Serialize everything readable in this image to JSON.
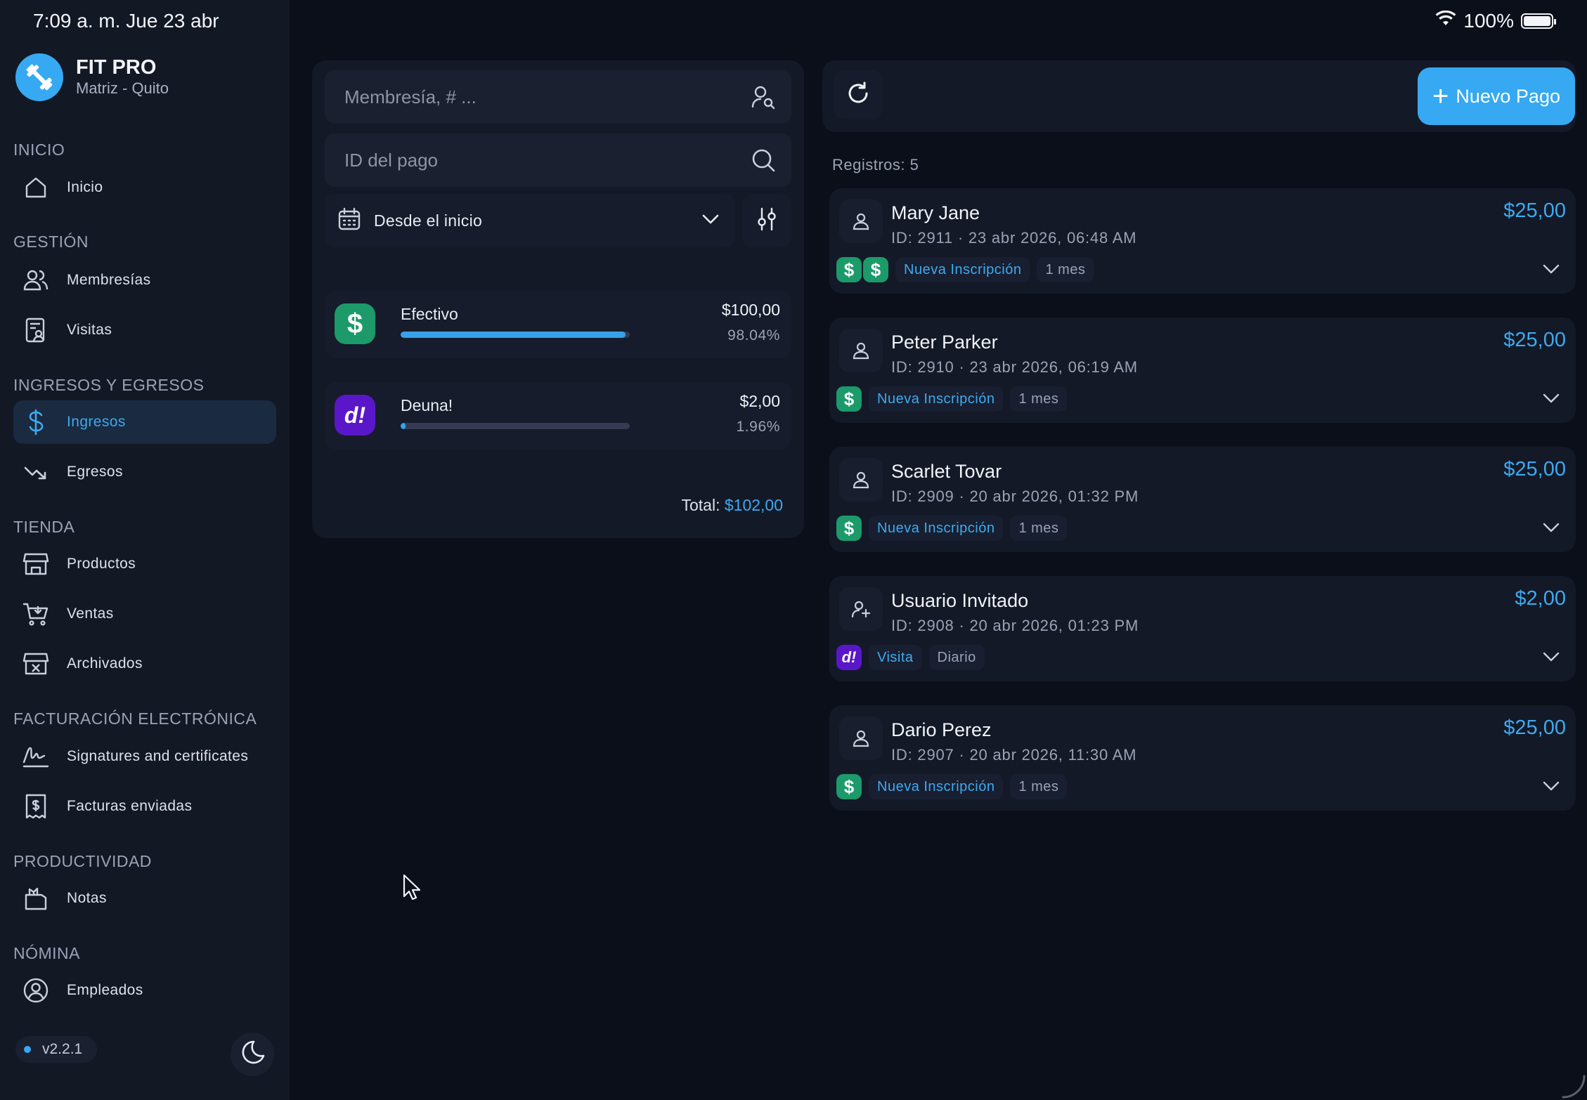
{
  "status_bar": {
    "time": "7:09 a. m.   Jue 23 abr",
    "battery": "100%",
    "battery_level": 1.0
  },
  "brand": {
    "name": "FIT PRO",
    "subtitle": "Matriz - Quito"
  },
  "sidebar": {
    "sections": [
      {
        "title": "INICIO"
      },
      {
        "title": "GESTIÓN"
      },
      {
        "title": "INGRESOS Y EGRESOS"
      },
      {
        "title": "TIENDA"
      },
      {
        "title": "FACTURACIÓN ELECTRÓNICA"
      },
      {
        "title": "PRODUCTIVIDAD"
      },
      {
        "title": "NÓMINA"
      }
    ],
    "items": [
      {
        "label": "Inicio",
        "icon": "home-icon"
      },
      {
        "label": "Membresías",
        "icon": "users-icon"
      },
      {
        "label": "Visitas",
        "icon": "visits-icon"
      },
      {
        "label": "Ingresos",
        "icon": "dollar-icon",
        "active": true
      },
      {
        "label": "Egresos",
        "icon": "trend-down-icon"
      },
      {
        "label": "Productos",
        "icon": "store-icon"
      },
      {
        "label": "Ventas",
        "icon": "cart-icon"
      },
      {
        "label": "Archivados",
        "icon": "archived-store-icon"
      },
      {
        "label": "Signatures and certificates",
        "icon": "signature-icon"
      },
      {
        "label": "Facturas enviadas",
        "icon": "invoice-icon"
      },
      {
        "label": "Notas",
        "icon": "notes-icon"
      },
      {
        "label": "Empleados",
        "icon": "employee-icon"
      }
    ],
    "version": "v2.2.1"
  },
  "filters": {
    "membership_placeholder": "Membresía, # ...",
    "payment_id_placeholder": "ID del pago",
    "date_range": "Desde el inicio"
  },
  "methods": [
    {
      "name": "Efectivo",
      "amount": "$100,00",
      "percent": "98.04%",
      "share": 0.9804,
      "icon": "cash-icon",
      "color": "#1c9a6a"
    },
    {
      "name": "Deuna!",
      "amount": "$2,00",
      "percent": "1.96%",
      "share": 0.0196,
      "icon": "deuna-icon",
      "color": "#5a17c9"
    }
  ],
  "total": {
    "label": "Total:",
    "value": "$102,00"
  },
  "toolbar": {
    "new_payment_label": "Nuevo Pago",
    "records": "Registros: 5"
  },
  "payments": [
    {
      "name": "Mary Jane",
      "meta": "ID: 2911  ·  23 abr 2026, 06:48 AM",
      "amount": "$25,00",
      "tag": "Nueva Inscripción",
      "duration": "1 mes",
      "method_icon_text": "$",
      "icon_count": 2,
      "avatar": "user-icon"
    },
    {
      "name": "Peter Parker",
      "meta": "ID: 2910  ·  23 abr 2026, 06:19 AM",
      "amount": "$25,00",
      "tag": "Nueva Inscripción",
      "duration": "1 mes",
      "method_icon_text": "$",
      "icon_count": 1,
      "avatar": "user-icon"
    },
    {
      "name": "Scarlet Tovar",
      "meta": "ID: 2909  ·  20 abr 2026, 01:32 PM",
      "amount": "$25,00",
      "tag": "Nueva Inscripción",
      "duration": "1 mes",
      "method_icon_text": "$",
      "icon_count": 1,
      "avatar": "user-icon"
    },
    {
      "name": "Usuario Invitado",
      "meta": "ID: 2908  ·  20 abr 2026, 01:23 PM",
      "amount": "$2,00",
      "tag": "Visita",
      "duration": "Diario",
      "method_icon_text": "d!",
      "icon_count": 1,
      "avatar": "user-plus-icon"
    },
    {
      "name": "Dario Perez",
      "meta": "ID: 2907  ·  20 abr 2026, 11:30 AM",
      "amount": "$25,00",
      "tag": "Nueva Inscripción",
      "duration": "1 mes",
      "method_icon_text": "$",
      "icon_count": 1,
      "avatar": "user-icon"
    }
  ],
  "colors": {
    "accent": "#36a9f2",
    "background": "#0b0f19",
    "panel": "#131927",
    "cash": "#1c9a6a",
    "deuna": "#5a17c9"
  }
}
